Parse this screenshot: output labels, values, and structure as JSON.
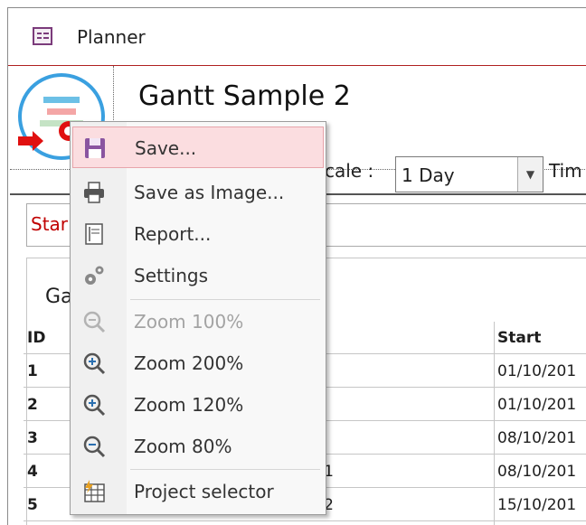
{
  "window": {
    "title": "Planner",
    "app_icon": "form-icon"
  },
  "header": {
    "title": "Gantt Sample 2",
    "logo_icon": "planner-logo-icon"
  },
  "toolbar": {
    "scale_label": "cale :",
    "scale_value": "1 Day",
    "time_label": "Tim"
  },
  "start_box": {
    "label": "Star"
  },
  "gantt": {
    "title": "Ga"
  },
  "grid": {
    "columns": [
      "ID",
      "Start"
    ],
    "rows": [
      {
        "id": "1",
        "name": "",
        "start": "01/10/201"
      },
      {
        "id": "2",
        "name": "",
        "start": "01/10/201"
      },
      {
        "id": "3",
        "name": "",
        "start": "08/10/201"
      },
      {
        "id": "4",
        "name": "ty 1",
        "start": "08/10/201"
      },
      {
        "id": "5",
        "name": "ty 2",
        "start": "15/10/201"
      }
    ]
  },
  "context_menu": {
    "items": [
      {
        "label": "Save...",
        "icon": "save-icon",
        "disabled": false,
        "highlighted": true
      },
      {
        "label": "Save as Image...",
        "icon": "printer-icon",
        "disabled": false
      },
      {
        "label": "Report...",
        "icon": "report-icon",
        "disabled": false
      },
      {
        "label": "Settings",
        "icon": "gears-icon",
        "disabled": false
      },
      {
        "label": "Zoom 100%",
        "icon": "zoom-reset-icon",
        "disabled": true
      },
      {
        "label": "Zoom 200%",
        "icon": "zoom-in-icon",
        "disabled": false
      },
      {
        "label": "Zoom 120%",
        "icon": "zoom-in-icon",
        "disabled": false
      },
      {
        "label": "Zoom 80%",
        "icon": "zoom-out-icon",
        "disabled": false
      },
      {
        "label": "Project selector",
        "icon": "project-selector-icon",
        "disabled": false
      }
    ]
  },
  "colors": {
    "accent_red": "#c00000",
    "menu_highlight": "#fbdde0",
    "logo_ring": "#3aa0e0"
  }
}
